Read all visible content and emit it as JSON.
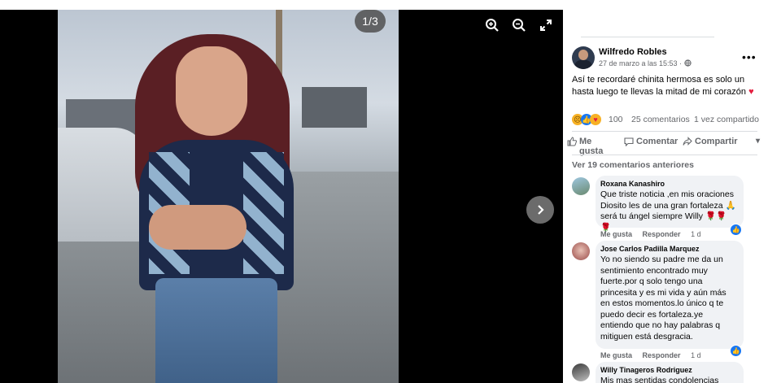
{
  "viewer": {
    "counter": "1/3",
    "zoom_in_icon": "zoom-in-icon",
    "zoom_out_icon": "zoom-out-icon",
    "fullscreen_icon": "fullscreen-icon",
    "next_icon": "chevron-right-icon"
  },
  "post": {
    "author": "Wilfredo Robles",
    "date": "27 de marzo a las 15:53 · ",
    "text": "Así te recordaré chinita hermosa es solo un hasta luego te llevas la mitad de mi corazón ",
    "text_emoji": "♥",
    "more": "•••"
  },
  "reactions": {
    "count": "100",
    "comments": "25 comentarios",
    "shares": "1 vez compartido"
  },
  "actions": {
    "like": "Me gusta",
    "comment": "Comentar",
    "share": "Compartir",
    "dropdown": "▾"
  },
  "comments_header": "Ver 19 comentarios anteriores",
  "comments": [
    {
      "name": "Roxana Kanashiro",
      "text": "Que triste noticia ,en mis oraciones Diosito les de una gran fortaleza 🙏 será tu ángel siempre Willy 🌹🌹🌹",
      "like": "Me gusta",
      "reply": "Responder",
      "age": "1 d"
    },
    {
      "name": "Jose Carlos Padilla Marquez",
      "text": "Yo no siendo su padre me da un sentimiento encontrado muy fuerte.por q solo tengo una princesita y es mi vida y aún más en estos momentos.lo único q te puedo decir es fortaleza.ye entiendo que no hay palabras q mitiguen está desgracia.",
      "like": "Me gusta",
      "reply": "Responder",
      "age": "1 d"
    },
    {
      "name": "Willy Tinageros Rodriguez",
      "text": "Mis mas sentidas condolencias",
      "like": "",
      "reply": "",
      "age": ""
    }
  ],
  "colors": {
    "brand_blue": "#1877f2",
    "heart_red": "#e41e3f",
    "text_secondary": "#65676b"
  }
}
